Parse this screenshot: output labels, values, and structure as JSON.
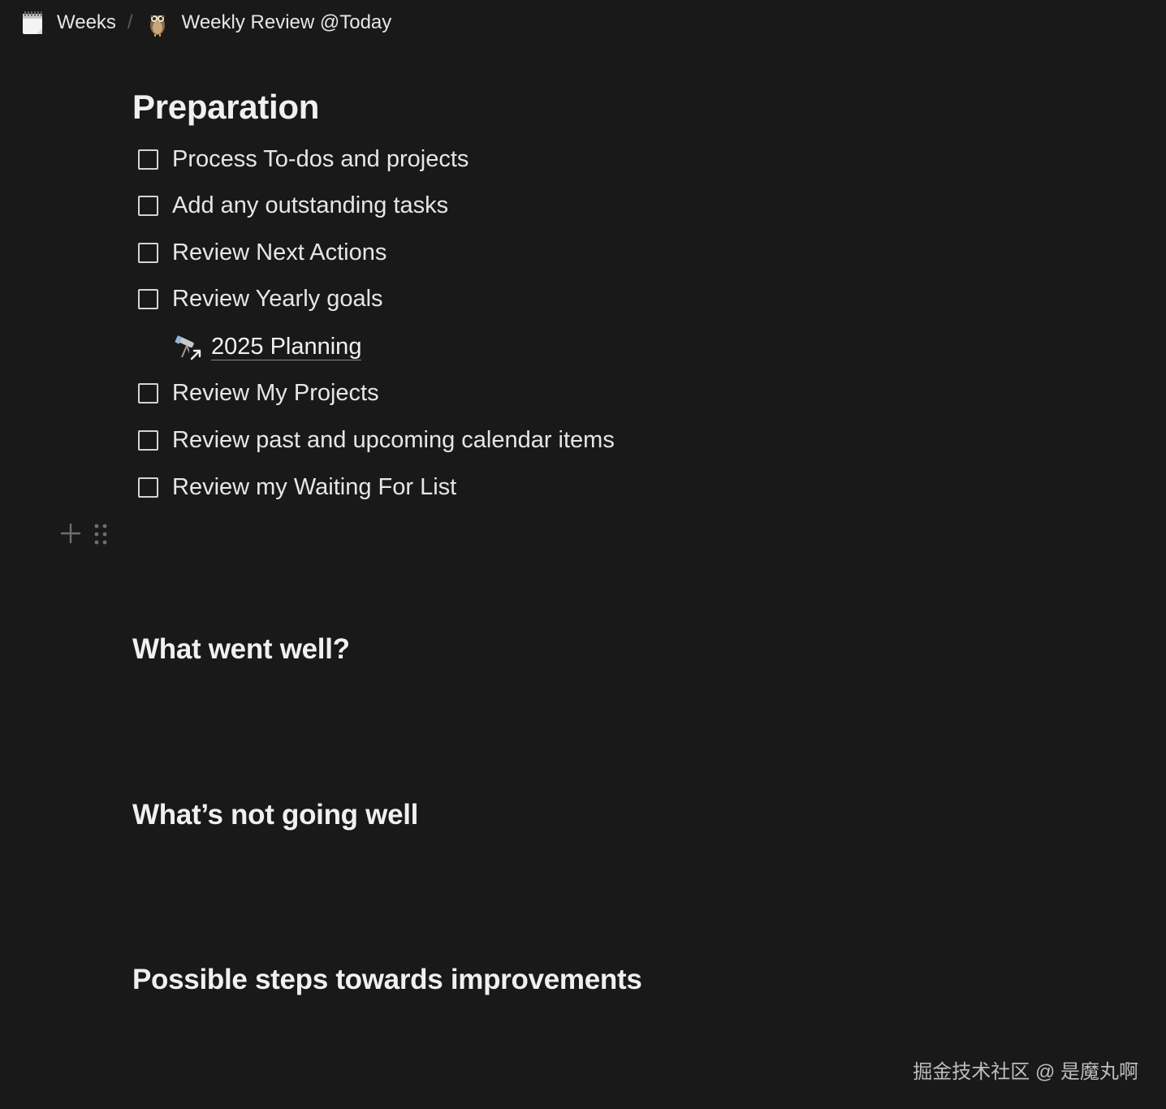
{
  "breadcrumb": {
    "items": [
      {
        "label": "Weeks",
        "icon": "notepad-icon"
      },
      {
        "label": "Weekly Review @Today",
        "icon": "owl-icon"
      }
    ],
    "separator": "/"
  },
  "content": {
    "title": "Preparation",
    "todos": [
      {
        "label": "Process To-dos and projects",
        "checked": false
      },
      {
        "label": "Add any outstanding tasks",
        "checked": false
      },
      {
        "label": "Review Next Actions",
        "checked": false
      },
      {
        "label": "Review Yearly goals",
        "checked": false
      },
      {
        "label": "Review My Projects",
        "checked": false
      },
      {
        "label": "Review past and upcoming calendar items",
        "checked": false
      },
      {
        "label": "Review my Waiting For List",
        "checked": false
      }
    ],
    "page_link": {
      "label": "2025 Planning",
      "icon": "telescope-icon"
    },
    "sections": [
      "What went well?",
      "What’s not going well",
      "Possible steps towards improvements"
    ]
  },
  "watermark": "掘金技术社区 @ 是魔丸啊"
}
